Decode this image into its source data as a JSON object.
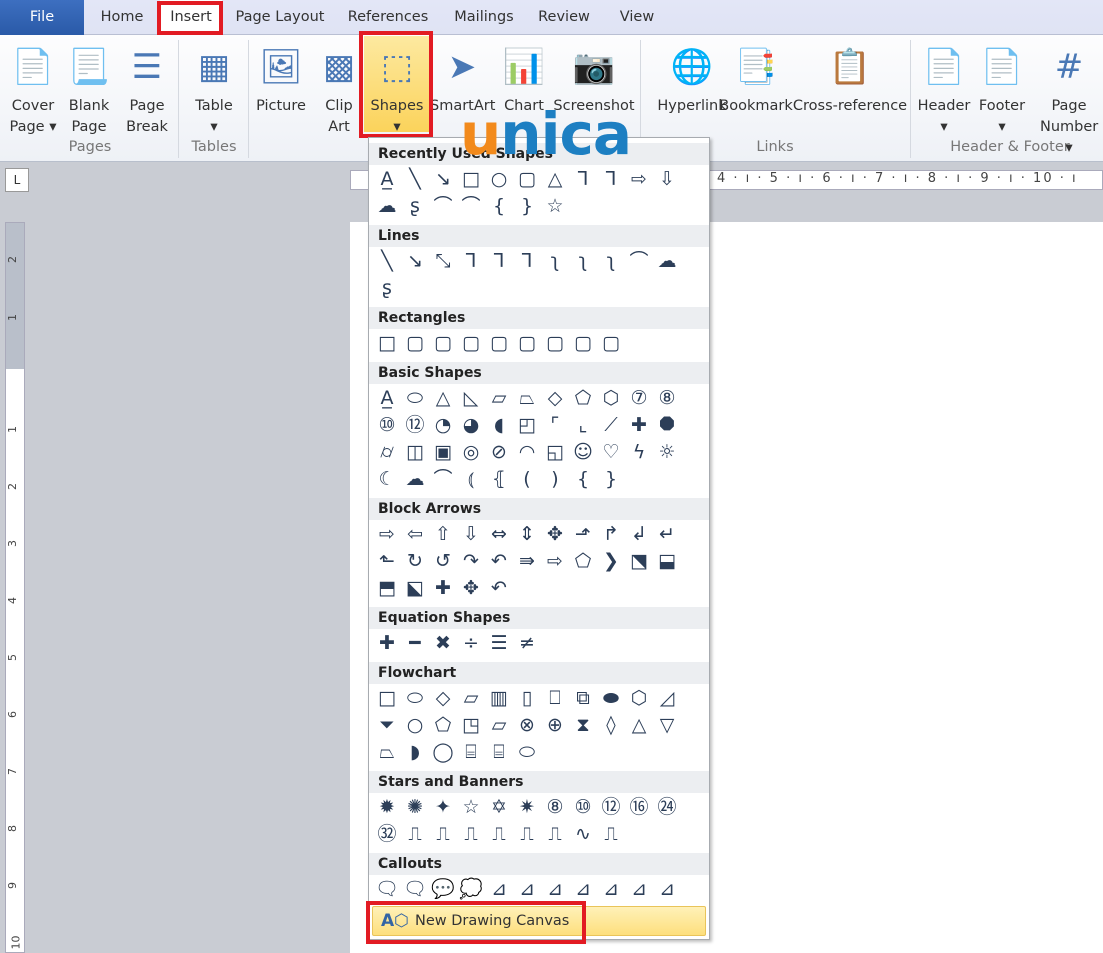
{
  "tabs": [
    "File",
    "Home",
    "Insert",
    "Page Layout",
    "References",
    "Mailings",
    "Review",
    "View"
  ],
  "active_tab": "Insert",
  "ribbon": {
    "buttons": [
      {
        "l1": "Cover",
        "l2": "Page ▾",
        "icon": "cover-page-icon"
      },
      {
        "l1": "Blank",
        "l2": "Page",
        "icon": "blank-page-icon"
      },
      {
        "l1": "Page",
        "l2": "Break",
        "icon": "page-break-icon"
      },
      {
        "l1": "Table",
        "l2": "▾",
        "icon": "table-icon"
      },
      {
        "l1": "Picture",
        "l2": "",
        "icon": "picture-icon"
      },
      {
        "l1": "Clip",
        "l2": "Art",
        "icon": "clip-art-icon"
      },
      {
        "l1": "Shapes",
        "l2": "▾",
        "icon": "shapes-icon"
      },
      {
        "l1": "SmartArt",
        "l2": "",
        "icon": "smartart-icon"
      },
      {
        "l1": "Chart",
        "l2": "",
        "icon": "chart-icon"
      },
      {
        "l1": "Screenshot",
        "l2": "",
        "icon": "screenshot-icon"
      },
      {
        "l1": "Hyperlink",
        "l2": "",
        "icon": "hyperlink-icon"
      },
      {
        "l1": "Bookmark",
        "l2": "",
        "icon": "bookmark-icon"
      },
      {
        "l1": "Cross-reference",
        "l2": "",
        "icon": "cross-reference-icon"
      },
      {
        "l1": "Header",
        "l2": "▾",
        "icon": "header-icon"
      },
      {
        "l1": "Footer",
        "l2": "▾",
        "icon": "footer-icon"
      },
      {
        "l1": "Page",
        "l2": "Number ▾",
        "icon": "page-number-icon"
      }
    ],
    "groups": [
      "Pages",
      "Tables",
      "Links",
      "Header & Footer"
    ]
  },
  "ruler": {
    "h": "4 · ı · 5 · ı · 6 · ı · 7 · ı · 8 · ı · 9 · ı · 10 · ı",
    "v": [
      "2",
      "1",
      "1",
      "2",
      "3",
      "4",
      "5",
      "6",
      "7",
      "8",
      "9",
      "10"
    ],
    "corner": "L"
  },
  "logo": {
    "u": "u",
    "rest": "nica"
  },
  "shapes_menu": {
    "sections": [
      {
        "title": "Recently Used Shapes",
        "shapes": [
          "A̲",
          "╲",
          "↘",
          "□",
          "○",
          "▢",
          "△",
          "⅂",
          "⅂",
          "⇨",
          "⇩",
          "☁",
          "ʂ",
          "⌒",
          "⌒",
          "{",
          "}",
          "☆"
        ]
      },
      {
        "title": "Lines",
        "shapes": [
          "╲",
          "↘",
          "⤡",
          "⅂",
          "⅂",
          "⅂",
          "ʅ",
          "ʅ",
          "ʅ",
          "⌒",
          "☁",
          "ʂ"
        ]
      },
      {
        "title": "Rectangles",
        "shapes": [
          "□",
          "▢",
          "▢",
          "▢",
          "▢",
          "▢",
          "▢",
          "▢",
          "▢"
        ]
      },
      {
        "title": "Basic Shapes",
        "shapes": [
          "A̲",
          "⬭",
          "△",
          "◺",
          "▱",
          "⏢",
          "◇",
          "⬠",
          "⬡",
          "⑦",
          "⑧",
          "⑩",
          "⑫",
          "◔",
          "◕",
          "◖",
          "◰",
          "⌜",
          "⌞",
          "⟋",
          "✚",
          "⯃",
          "⌭",
          "◫",
          "▣",
          "◎",
          "⊘",
          "◠",
          "◱",
          "☺",
          "♡",
          "ϟ",
          "☼",
          "☾",
          "☁",
          "⌒",
          "⦅",
          "⦃",
          "(",
          ")",
          "{",
          "}"
        ]
      },
      {
        "title": "Block Arrows",
        "shapes": [
          "⇨",
          "⇦",
          "⇧",
          "⇩",
          "⇔",
          "⇕",
          "✥",
          "⬏",
          "↱",
          "↲",
          "↵",
          "⬑",
          "↻",
          "↺",
          "↷",
          "↶",
          "⇛",
          "⇨",
          "⬠",
          "❯",
          "⬔",
          "⬓",
          "⬒",
          "⬕",
          "✚",
          "✥",
          "↶"
        ]
      },
      {
        "title": "Equation Shapes",
        "shapes": [
          "✚",
          "━",
          "✖",
          "÷",
          "☰",
          "≠"
        ]
      },
      {
        "title": "Flowchart",
        "shapes": [
          "□",
          "⬭",
          "◇",
          "▱",
          "▥",
          "▯",
          "⎕",
          "⧉",
          "⬬",
          "⬡",
          "◿",
          "⏷",
          "○",
          "⬠",
          "◳",
          "▱",
          "⊗",
          "⊕",
          "⧗",
          "◊",
          "△",
          "▽",
          "⏢",
          "◗",
          "◯",
          "⌸",
          "⌸",
          "⬭"
        ]
      },
      {
        "title": "Stars and Banners",
        "shapes": [
          "✹",
          "✺",
          "✦",
          "☆",
          "✡",
          "✷",
          "⑧",
          "⑩",
          "⑫",
          "⑯",
          "㉔",
          "㉜",
          "⎍",
          "⎍",
          "⎍",
          "⎍",
          "⎍",
          "⎍",
          "∿",
          "⎍"
        ]
      },
      {
        "title": "Callouts",
        "shapes": [
          "🗨",
          "🗨",
          "💬",
          "💭",
          "⊿",
          "⊿",
          "⊿",
          "⊿",
          "⊿",
          "⊿",
          "⊿",
          "⊿",
          "⊿",
          "⊿",
          "⊿",
          "⊿"
        ]
      }
    ],
    "new_canvas": "New Drawing Canvas"
  }
}
